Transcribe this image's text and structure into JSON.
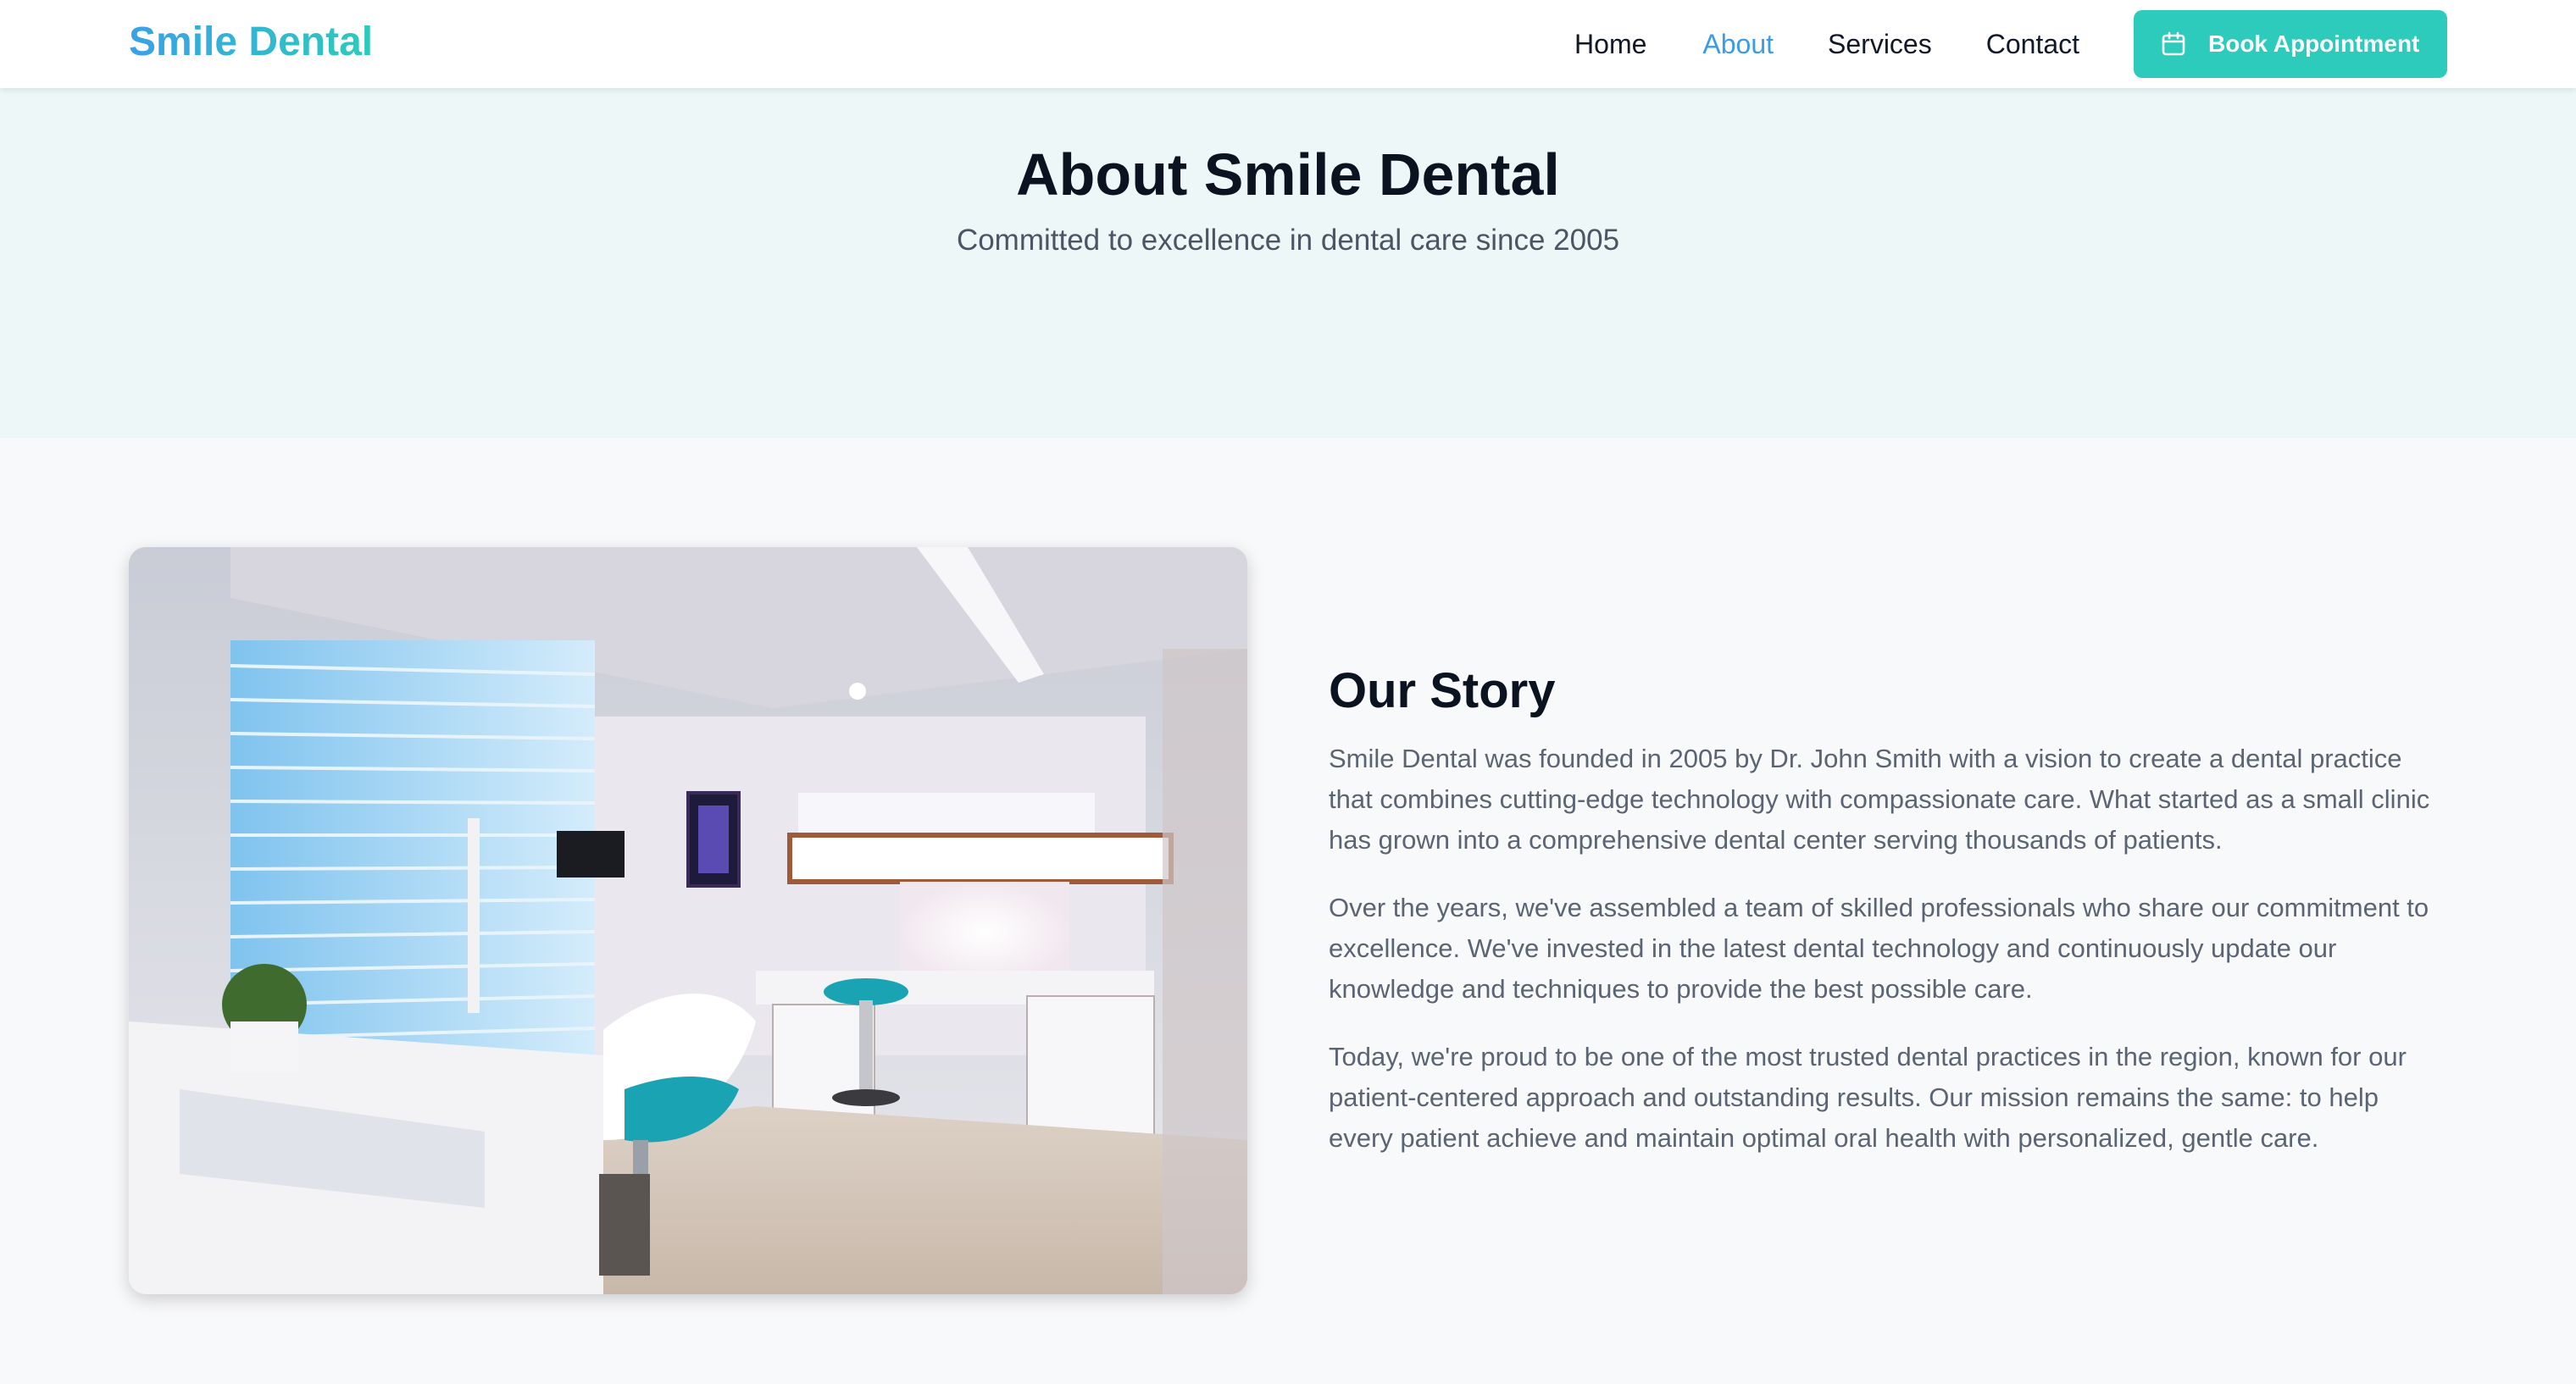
{
  "brand": {
    "name": "Smile Dental"
  },
  "nav": {
    "items": [
      {
        "label": "Home",
        "active": false
      },
      {
        "label": "About",
        "active": true
      },
      {
        "label": "Services",
        "active": false
      },
      {
        "label": "Contact",
        "active": false
      }
    ],
    "cta": {
      "label": "Book Appointment",
      "icon": "calendar-icon"
    }
  },
  "hero": {
    "title": "About Smile Dental",
    "subtitle": "Committed to excellence in dental care since 2005"
  },
  "story": {
    "image_icon": "dental-clinic-photo",
    "title": "Our Story",
    "paragraphs": [
      "Smile Dental was founded in 2005 by Dr. John Smith with a vision to create a dental practice that combines cutting-edge technology with compassionate care. What started as a small clinic has grown into a comprehensive dental center serving thousands of patients.",
      "Over the years, we've assembled a team of skilled professionals who share our commitment to excellence. We've invested in the latest dental technology and continuously update our knowledge and techniques to provide the best possible care.",
      "Today, we're proud to be one of the most trusted dental practices in the region, known for our patient-centered approach and outstanding results. Our mission remains the same: to help every patient achieve and maintain optimal oral health with personalized, gentle care."
    ]
  },
  "colors": {
    "brand_blue": "#3aa0e8",
    "brand_teal": "#2ccbbb",
    "hero_bg": "#edf7f7",
    "page_bg": "#f8f9fb",
    "active_link": "#3b9be6"
  }
}
